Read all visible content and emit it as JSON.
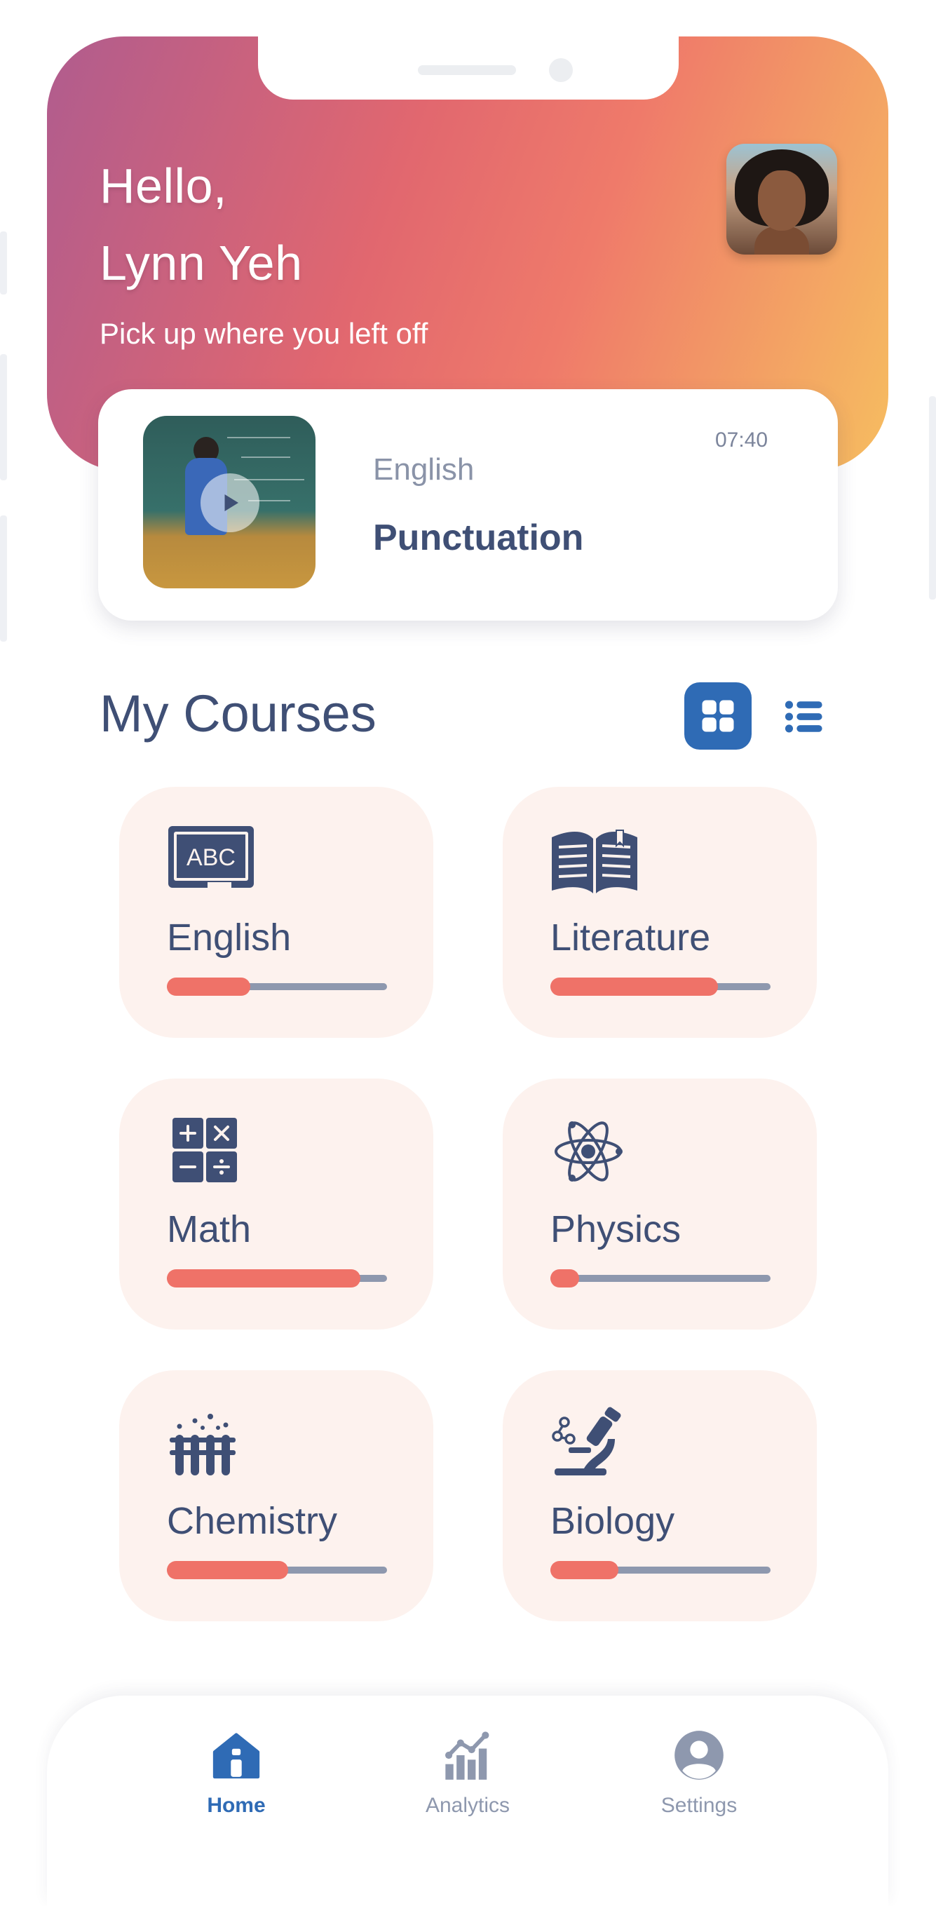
{
  "header": {
    "greeting_line1": "Hello,",
    "greeting_line2": "Lynn Yeh",
    "subtitle": "Pick up where you left off",
    "gradient_colors": [
      "#b05c8e",
      "#e1676f",
      "#f6bd60"
    ]
  },
  "resume": {
    "subject": "English",
    "lesson": "Punctuation",
    "time": "07:40"
  },
  "courses_section": {
    "title": "My Courses",
    "active_view": "grid"
  },
  "courses": [
    {
      "label": "English",
      "icon": "abc-board-icon",
      "progress": 0.38
    },
    {
      "label": "Literature",
      "icon": "open-book-icon",
      "progress": 0.76
    },
    {
      "label": "Math",
      "icon": "calculator-icon",
      "progress": 0.88
    },
    {
      "label": "Physics",
      "icon": "atom-icon",
      "progress": 0.13
    },
    {
      "label": "Chemistry",
      "icon": "test-tubes-icon",
      "progress": 0.55
    },
    {
      "label": "Biology",
      "icon": "microscope-icon",
      "progress": 0.31
    }
  ],
  "nav": {
    "items": [
      {
        "label": "Home",
        "icon": "home-icon",
        "active": true
      },
      {
        "label": "Analytics",
        "icon": "analytics-icon",
        "active": false
      },
      {
        "label": "Settings",
        "icon": "user-circle-icon",
        "active": false
      }
    ]
  },
  "colors": {
    "primary": "#2f6bb5",
    "text": "#3f4f75",
    "progress": "#ef7268",
    "card_bg": "#fdf2ee"
  }
}
